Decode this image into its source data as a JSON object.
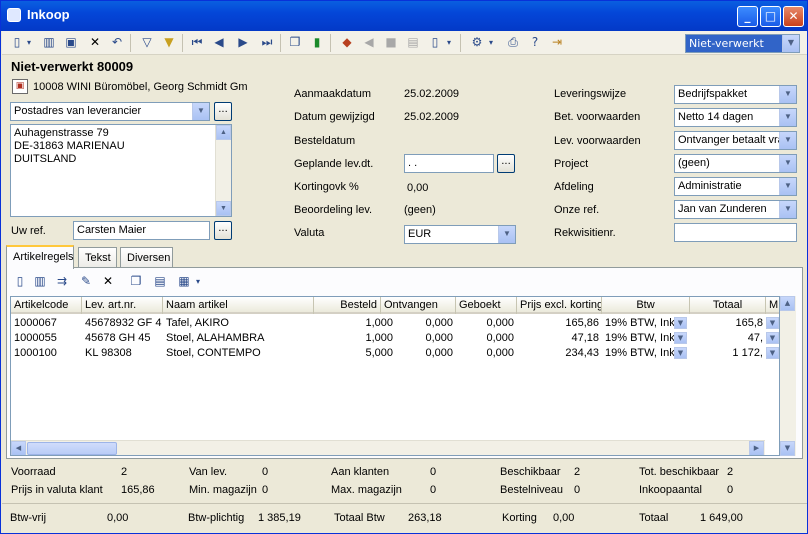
{
  "window": {
    "title": "Inkoop"
  },
  "toolbar": {
    "status_value": "Niet-verwerkt"
  },
  "header": {
    "title": "Niet-verwerkt 80009",
    "supplier": "10008 WINI Büromöbel, Georg Schmidt Gm"
  },
  "address": {
    "type_select": "Postadres van leverancier",
    "lines": [
      "Auhagenstrasse 79",
      "DE-31863 MARIENAU",
      "DUITSLAND"
    ]
  },
  "uw_ref": {
    "label": "Uw ref.",
    "value": "Carsten Maier"
  },
  "middle": {
    "aanmaakdatum_label": "Aanmaakdatum",
    "aanmaakdatum": "25.02.2009",
    "gewijzigd_label": "Datum gewijzigd",
    "gewijzigd": "25.02.2009",
    "besteldatum_label": "Besteldatum",
    "geplande_label": "Geplande lev.dt.",
    "geplande": "  .  .",
    "korting_label": "Kortingovk %",
    "korting": "0,00",
    "beoordeling_label": "Beoordeling lev.",
    "beoordeling": "(geen)",
    "valuta_label": "Valuta",
    "valuta": "EUR"
  },
  "right": {
    "leveringswijze_label": "Leveringswijze",
    "leveringswijze": "Bedrijfspakket",
    "betvw_label": "Bet. voorwaarden",
    "betvw": "Netto 14 dagen",
    "levvw_label": "Lev. voorwaarden",
    "levvw": "Ontvanger betaalt vra",
    "project_label": "Project",
    "project": "(geen)",
    "afdeling_label": "Afdeling",
    "afdeling": "Administratie",
    "onzeref_label": "Onze ref.",
    "onzeref": "Jan van Zunderen",
    "rekwisitie_label": "Rekwisitienr.",
    "rekwisitie": ""
  },
  "tabs": [
    "Artikelregels",
    "Tekst",
    "Diversen"
  ],
  "grid": {
    "columns": [
      "Artikelcode",
      "Lev. art.nr.",
      "Naam artikel",
      "Besteld",
      "Ontvangen",
      "Geboekt",
      "Prijs excl. korting",
      "Btw",
      "Totaal",
      "M"
    ],
    "rows": [
      {
        "code": "1000067",
        "levnr": "45678932 GF 4",
        "naam": "Tafel, AKIRO",
        "besteld": "1,000",
        "ontvangen": "0,000",
        "geboekt": "0,000",
        "prijs": "165,86",
        "btw": "19% BTW, Ink",
        "totaal": "165,8"
      },
      {
        "code": "1000055",
        "levnr": "45678 GH 45",
        "naam": "Stoel, ALAHAMBRA",
        "besteld": "1,000",
        "ontvangen": "0,000",
        "geboekt": "0,000",
        "prijs": "47,18",
        "btw": "19% BTW, Ink",
        "totaal": "47,"
      },
      {
        "code": "1000100",
        "levnr": "KL 98308",
        "naam": "Stoel, CONTEMPO",
        "besteld": "5,000",
        "ontvangen": "0,000",
        "geboekt": "0,000",
        "prijs": "234,43",
        "btw": "19% BTW, Ink",
        "totaal": "1 172,"
      }
    ]
  },
  "stock": {
    "voorraad_label": "Voorraad",
    "voorraad": "2",
    "prijs_valuta_label": "Prijs in valuta klant",
    "prijs_valuta": "165,86",
    "vanlev_label": "Van lev.",
    "vanlev": "0",
    "minmag_label": "Min. magazijn",
    "minmag": "0",
    "aanklanten_label": "Aan klanten",
    "aanklanten": "0",
    "maxmag_label": "Max. magazijn",
    "maxmag": "0",
    "beschikbaar_label": "Beschikbaar",
    "beschikbaar": "2",
    "bestelniveau_label": "Bestelniveau",
    "bestelniveau": "0",
    "totbeschikbaar_label": "Tot. beschikbaar",
    "totbeschikbaar": "2",
    "inkoopaantal_label": "Inkoopaantal",
    "inkoopaantal": "0"
  },
  "totals": {
    "btwvrij_label": "Btw-vrij",
    "btwvrij": "0,00",
    "btwplichtig_label": "Btw-plichtig",
    "btwplichtig": "1 385,19",
    "totaalbtw_label": "Totaal Btw",
    "totaalbtw": "263,18",
    "korting_label": "Korting",
    "korting": "0,00",
    "totaal_label": "Totaal",
    "totaal": "1 649,00"
  }
}
